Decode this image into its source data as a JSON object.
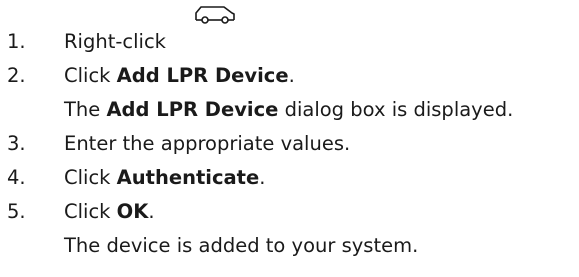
{
  "steps": [
    {
      "number": "1.",
      "text": "Right-click",
      "icon": "car-icon"
    },
    {
      "number": "2.",
      "text_before": "Click ",
      "bold": "Add LPR Device",
      "text_after": "."
    },
    {
      "note_before": "The ",
      "note_bold": "Add LPR Device",
      "note_after": " dialog box is displayed."
    },
    {
      "number": "3.",
      "text": "Enter the appropriate values."
    },
    {
      "number": "4.",
      "text_before": "Click ",
      "bold": "Authenticate",
      "text_after": "."
    },
    {
      "number": "5.",
      "text_before": "Click ",
      "bold": "OK",
      "text_after": "."
    },
    {
      "note": "The device is added to your system."
    }
  ]
}
